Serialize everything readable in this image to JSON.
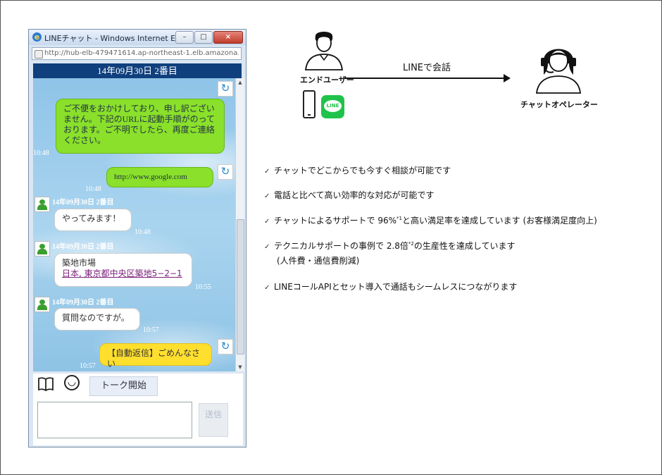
{
  "window": {
    "title": "LINEチャット - Windows Internet Expl...",
    "url": "http://hub-elb-479471614.ap-northeast-1.elb.amazona...",
    "minimize": "–",
    "maximize": "□",
    "close": "×"
  },
  "chat": {
    "header": "14年09月30日 2番目",
    "messages": [
      {
        "text": "ご不便をおかけしており、申し訳ございません。下記のURLに起動手順がのっております。ご不明でしたら、再度ご連絡ください。",
        "time": "10:48"
      },
      {
        "text": "http://www.google.com",
        "time": "10:48"
      },
      {
        "user": "14年09月30日 2番目",
        "text": "やってみます！",
        "time": "10:48"
      },
      {
        "user": "14年09月30日 2番目",
        "line1": "築地市場",
        "line2": "日本, 東京都中央区築地5−2−1",
        "time": "10:55"
      },
      {
        "user": "14年09月30日 2番目",
        "text": "質問なのですが。",
        "time": "10:57"
      },
      {
        "text": "【自動返信】ごめんなさい",
        "time": "10:57"
      }
    ],
    "talk_button": "トーク開始",
    "send_button": "送信"
  },
  "diagram": {
    "end_user": "エンドユーザー",
    "operator": "チャットオペレーター",
    "line_talk": "LINEで会話",
    "line_logo": "LINE"
  },
  "features": [
    {
      "text": "チャットでどこからでも今すぐ相談が可能です"
    },
    {
      "text": "電話と比べて高い効率的な対応が可能です"
    },
    {
      "pre": "チャットによるサポートで 96%",
      "sup": "*1",
      "post": "と高い満足率を達成しています (お客様満足度向上)"
    },
    {
      "pre": "テクニカルサポートの事例で 2.8倍",
      "sup": "*2",
      "post": "の生産性を達成しています",
      "sub": "(人件費・通信費削減)"
    },
    {
      "text": "LINEコールAPIとセット導入で通話もシームレスにつながります"
    }
  ]
}
